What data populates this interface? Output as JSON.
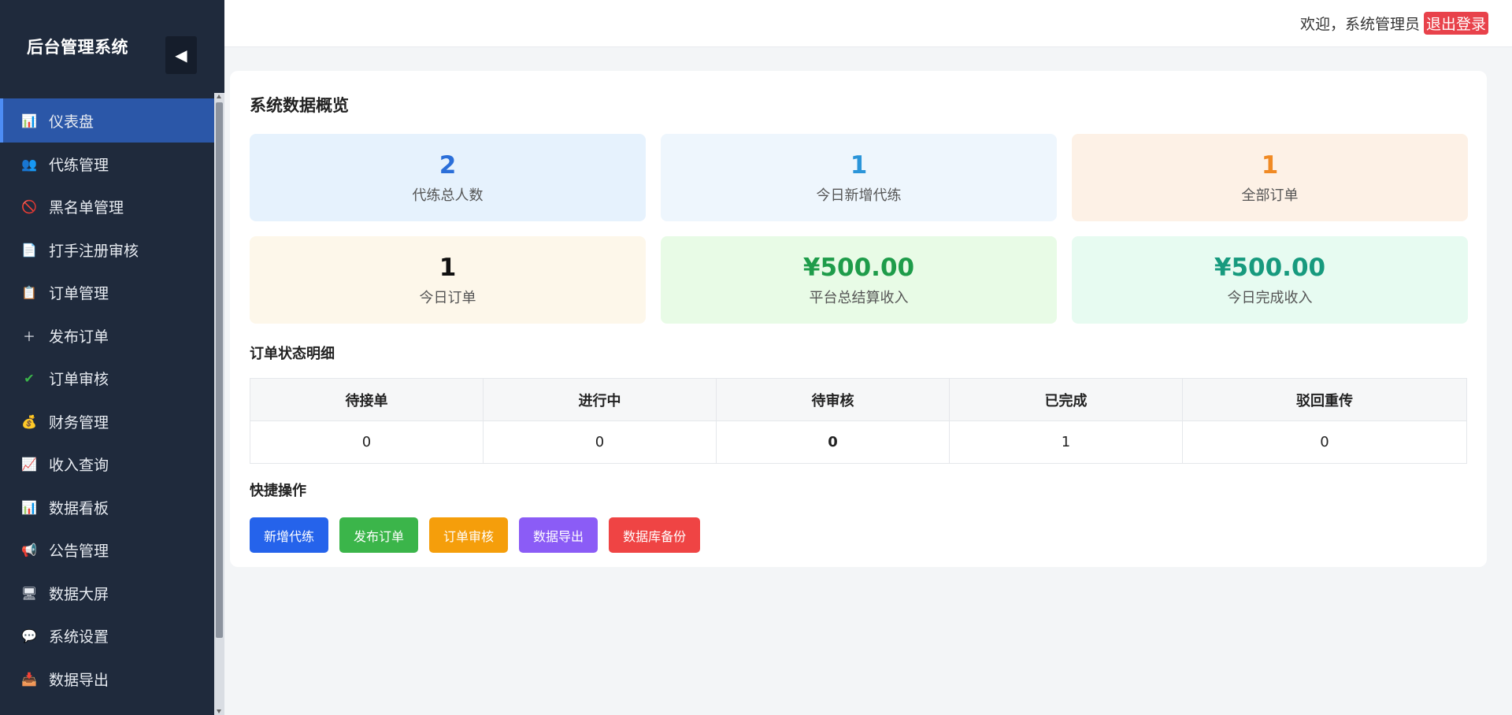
{
  "sidebar": {
    "title": "后台管理系统",
    "collapse_glyph": "◀",
    "items": [
      {
        "label": "仪表盘",
        "icon": "bar-chart-icon",
        "glyph": "📊"
      },
      {
        "label": "代练管理",
        "icon": "users-icon",
        "glyph": "👥"
      },
      {
        "label": "黑名单管理",
        "icon": "prohibited-icon",
        "glyph": "🚫"
      },
      {
        "label": "打手注册审核",
        "icon": "document-icon",
        "glyph": "📄"
      },
      {
        "label": "订单管理",
        "icon": "clipboard-icon",
        "glyph": "📋"
      },
      {
        "label": "发布订单",
        "icon": "plus-icon",
        "glyph": "＋"
      },
      {
        "label": "订单审核",
        "icon": "check-icon",
        "glyph": "✔"
      },
      {
        "label": "财务管理",
        "icon": "money-bag-icon",
        "glyph": "💰"
      },
      {
        "label": "收入查询",
        "icon": "trend-chart-icon",
        "glyph": "📈"
      },
      {
        "label": "数据看板",
        "icon": "bar-chart-icon",
        "glyph": "📊"
      },
      {
        "label": "公告管理",
        "icon": "megaphone-icon",
        "glyph": "📢"
      },
      {
        "label": "数据大屏",
        "icon": "monitor-icon",
        "glyph": "🖥"
      },
      {
        "label": "系统设置",
        "icon": "chat-bubble-icon",
        "glyph": "💬"
      },
      {
        "label": "数据导出",
        "icon": "download-tray-icon",
        "glyph": "📥"
      }
    ]
  },
  "header": {
    "welcome": "欢迎，系统管理员",
    "logout": "退出登录"
  },
  "overview": {
    "title": "系统数据概览",
    "stats": [
      {
        "value": "2",
        "label": "代练总人数",
        "color": "#2b6fd9",
        "bg": "#e6f2fd"
      },
      {
        "value": "1",
        "label": "今日新增代练",
        "color": "#2b95d9",
        "bg": "#eef6fd"
      },
      {
        "value": "1",
        "label": "全部订单",
        "color": "#f08a24",
        "bg": "#fdf1e6"
      },
      {
        "value": "1",
        "label": "今日订单",
        "color": "#111111",
        "bg": "#fdf7ea"
      },
      {
        "value": "¥500.00",
        "label": "平台总结算收入",
        "color": "#1e9c4a",
        "bg": "#e8fbe6"
      },
      {
        "value": "¥500.00",
        "label": "今日完成收入",
        "color": "#179a7e",
        "bg": "#e7fbf1"
      }
    ]
  },
  "order_status": {
    "title": "订单状态明细",
    "headers": [
      "待接单",
      "进行中",
      "待审核",
      "已完成",
      "驳回重传"
    ],
    "values": [
      "0",
      "0",
      "0",
      "1",
      "0"
    ]
  },
  "quick_actions": {
    "title": "快捷操作",
    "buttons": [
      {
        "label": "新增代练",
        "color": "#2563eb"
      },
      {
        "label": "发布订单",
        "color": "#3bb54a"
      },
      {
        "label": "订单审核",
        "color": "#f59e0b"
      },
      {
        "label": "数据导出",
        "color": "#8b5cf6"
      },
      {
        "label": "数据库备份",
        "color": "#ef4444"
      }
    ]
  }
}
